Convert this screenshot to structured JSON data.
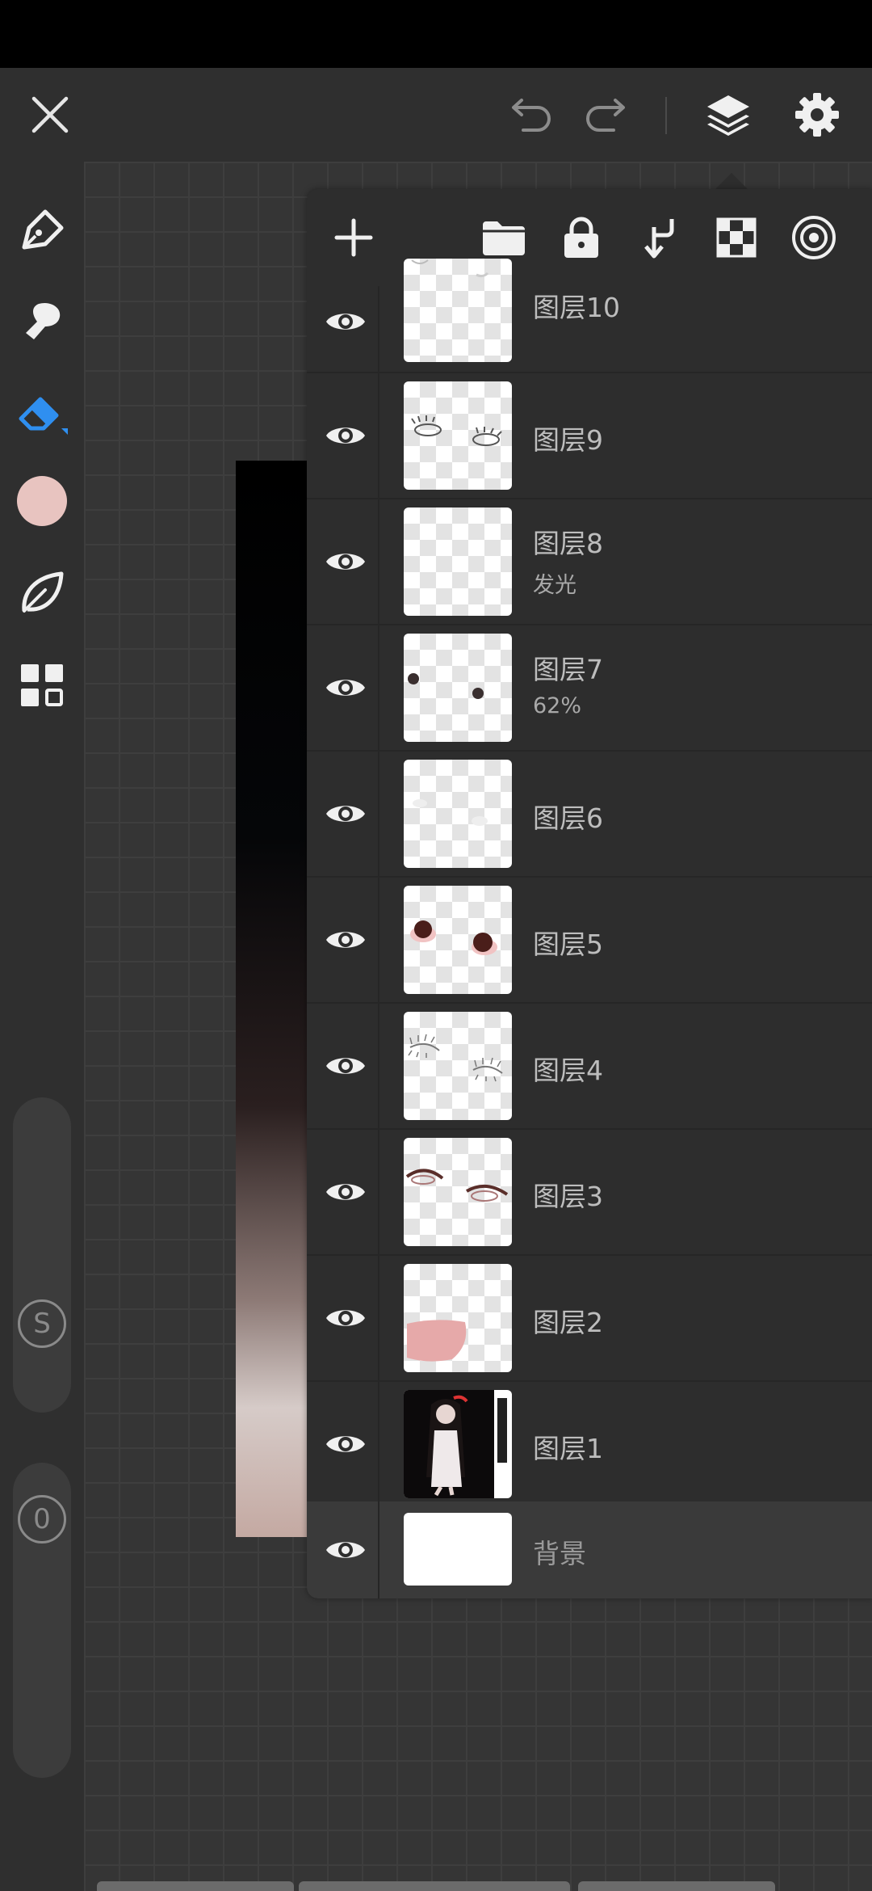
{
  "layers": [
    {
      "name": "图层10",
      "sub": ""
    },
    {
      "name": "图层9",
      "sub": ""
    },
    {
      "name": "图层8",
      "sub": "发光"
    },
    {
      "name": "图层7",
      "sub": "62%"
    },
    {
      "name": "图层6",
      "sub": ""
    },
    {
      "name": "图层5",
      "sub": ""
    },
    {
      "name": "图层4",
      "sub": ""
    },
    {
      "name": "图层3",
      "sub": ""
    },
    {
      "name": "图层2",
      "sub": ""
    },
    {
      "name": "图层1",
      "sub": ""
    },
    {
      "name": "背景",
      "sub": ""
    }
  ],
  "left_pills": {
    "s_label": "S",
    "zero_label": "0"
  },
  "colors": {
    "current_color": "#e8c4c0",
    "accent": "#2f8ff0"
  },
  "icons": {
    "close": "close-icon",
    "undo": "undo-icon",
    "redo": "redo-icon",
    "layers": "layers-icon",
    "settings": "gear-icon",
    "pen": "pen-icon",
    "smudge": "smudge-icon",
    "eraser": "eraser-icon",
    "leaf": "leaf-icon",
    "grid": "grid-icon",
    "add": "add-icon",
    "folder": "folder-icon",
    "lock": "lock-icon",
    "merge_down": "merge-down-icon",
    "checker": "checkerboard-icon",
    "target": "target-icon",
    "eye": "eye-icon"
  }
}
